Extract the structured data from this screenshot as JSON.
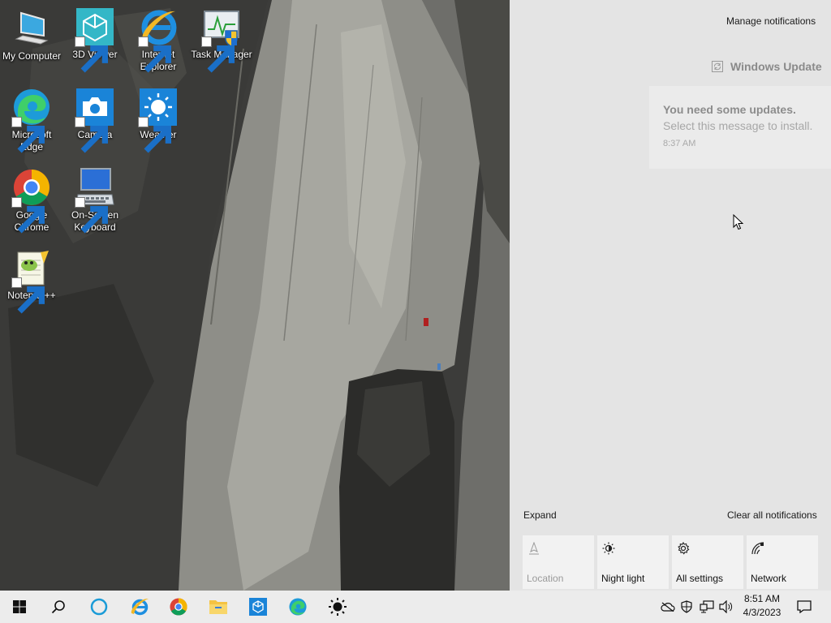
{
  "desktop": {
    "icons": [
      {
        "label": "My Computer",
        "icon": "computer-icon"
      },
      {
        "label": "3D Viewer",
        "icon": "3d-viewer-icon"
      },
      {
        "label": "Internet Explorer",
        "icon": "internet-explorer-icon"
      },
      {
        "label": "Task Manager",
        "icon": "task-manager-icon"
      },
      {
        "label": "Microsoft Edge",
        "icon": "edge-icon"
      },
      {
        "label": "Camera",
        "icon": "camera-icon"
      },
      {
        "label": "Weather",
        "icon": "weather-icon"
      },
      {
        "label": "Google Chrome",
        "icon": "chrome-icon"
      },
      {
        "label": "On-Screen Keyboard",
        "icon": "keyboard-icon"
      },
      {
        "label": "Notepad++",
        "icon": "notepadpp-icon"
      }
    ]
  },
  "action_center": {
    "manage_label": "Manage notifications",
    "group_title": "Windows Update",
    "notification": {
      "title": "You need some updates.",
      "body": "Select this message to install.",
      "time": "8:37 AM"
    },
    "expand_label": "Expand",
    "clear_label": "Clear all notifications",
    "quick_actions": [
      {
        "label": "Location",
        "icon": "location-icon",
        "enabled": false
      },
      {
        "label": "Night light",
        "icon": "night-light-icon",
        "enabled": true
      },
      {
        "label": "All settings",
        "icon": "gear-icon",
        "enabled": true
      },
      {
        "label": "Network",
        "icon": "network-icon",
        "enabled": true
      }
    ]
  },
  "taskbar": {
    "pinned": [
      "start-icon",
      "search-icon",
      "cortana-icon",
      "internet-explorer-icon",
      "chrome-icon",
      "file-explorer-icon",
      "3d-viewer-icon",
      "edge-icon",
      "weather-icon"
    ],
    "tray": [
      "onedrive-icon",
      "security-icon",
      "network-icon",
      "volume-icon"
    ],
    "time": "8:51 AM",
    "date": "4/3/2023"
  },
  "colors": {
    "action_center_bg": "#e4e4e4",
    "taskbar_bg": "#ececec",
    "tile_bg": "#f2f2f2",
    "icon_blue": "#1a9bd7"
  }
}
